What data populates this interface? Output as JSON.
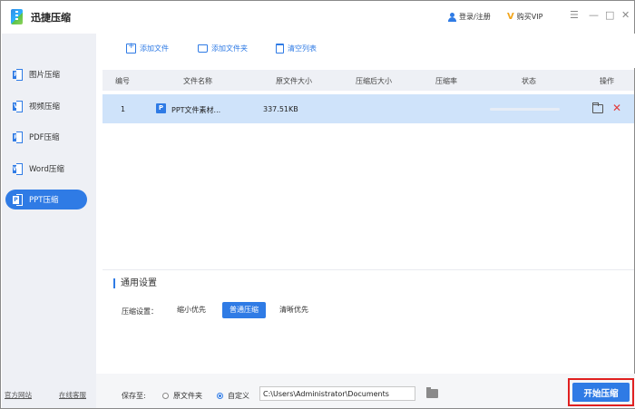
{
  "app": {
    "title": "迅捷压缩"
  },
  "header": {
    "login_label": "登录/注册",
    "vip_label": "购买VIP"
  },
  "window_controls": {
    "menu": "☰",
    "minimize": "—",
    "maximize": "□",
    "close": "✕"
  },
  "sidebar": {
    "items": [
      {
        "label": "图片压缩",
        "icon": "image-compress-icon",
        "badge": "P"
      },
      {
        "label": "视频压缩",
        "icon": "video-compress-icon",
        "badge": "V"
      },
      {
        "label": "PDF压缩",
        "icon": "pdf-compress-icon",
        "badge": "P"
      },
      {
        "label": "Word压缩",
        "icon": "word-compress-icon",
        "badge": "W"
      },
      {
        "label": "PPT压缩",
        "icon": "ppt-compress-icon",
        "badge": "P",
        "active": true
      }
    ],
    "footer": {
      "website": "官方网站",
      "support": "在线客服"
    }
  },
  "toolbar": {
    "add_file": "添加文件",
    "add_folder": "添加文件夹",
    "clear_list": "清空列表"
  },
  "table": {
    "columns": [
      "编号",
      "文件名称",
      "原文件大小",
      "压缩后大小",
      "压缩率",
      "状态",
      "操作"
    ],
    "rows": [
      {
        "index": "1",
        "icon": "P",
        "name": "PPT文件素材...",
        "original_size": "337.51KB",
        "compressed_size": "",
        "ratio": "",
        "progress": 0
      }
    ]
  },
  "settings": {
    "title": "通用设置",
    "compress_label": "压缩设置：",
    "options": [
      "缩小优先",
      "普通压缩",
      "清晰优先"
    ],
    "selected": "普通压缩"
  },
  "bottom": {
    "save_label": "保存至:",
    "radio_original": "原文件夹",
    "radio_custom": "自定义",
    "selected": "自定义",
    "path": "C:\\Users\\Administrator\\Documents",
    "start_button": "开始压缩"
  },
  "colors": {
    "accent": "#2f7be5",
    "selected_row": "#cfe3fa",
    "sidebar_bg": "#eef0f5",
    "highlight_border": "#e02020"
  }
}
